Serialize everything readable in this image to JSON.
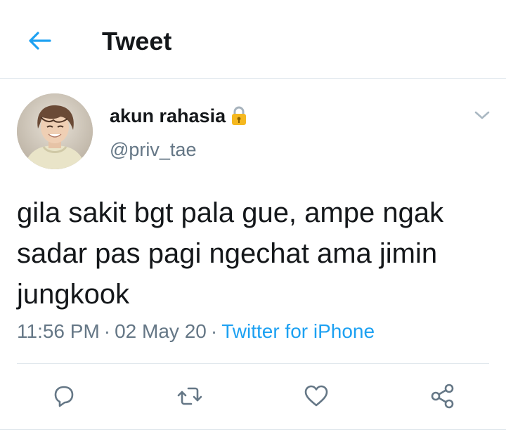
{
  "header": {
    "title": "Tweet",
    "back_icon": "arrow-left-icon"
  },
  "tweet": {
    "display_name": "akun rahasia",
    "handle": "@priv_tae",
    "protected_icon": "lock-icon",
    "text": "gila sakit bgt pala gue, ampe ngak\nsadar pas pagi ngechat ama jimin\njungkook",
    "time": "11:56 PM",
    "separator": "·",
    "date": "02 May 20",
    "source": "Twitter for iPhone"
  },
  "actions": {
    "reply_icon": "reply-icon",
    "retweet_icon": "retweet-icon",
    "like_icon": "heart-icon",
    "share_icon": "share-icon"
  },
  "colors": {
    "accent": "#1da1f2",
    "text_primary": "#14171a",
    "text_secondary": "#657786",
    "divider": "#e1e8ed",
    "lock": "#f5b820"
  }
}
